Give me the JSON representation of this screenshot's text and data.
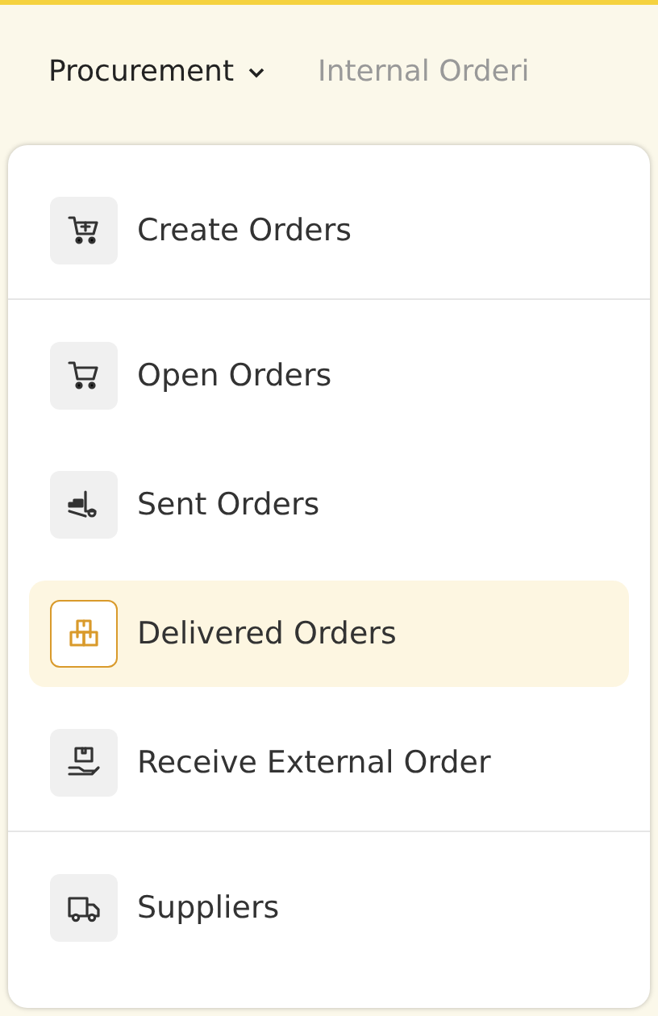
{
  "nav": [
    {
      "label": "Procurement",
      "selected": true,
      "dropdown": true
    },
    {
      "label": "Internal Orderi",
      "selected": false,
      "dropdown": false
    }
  ],
  "menu": {
    "groups": [
      {
        "items": [
          {
            "label": "Create Orders",
            "kind": "cart-plus",
            "selected": false
          }
        ]
      },
      {
        "items": [
          {
            "label": "Open Orders",
            "kind": "cart",
            "selected": false
          },
          {
            "label": "Sent Orders",
            "kind": "forklift",
            "selected": false
          },
          {
            "label": "Delivered Orders",
            "kind": "boxes",
            "selected": true
          },
          {
            "label": "Receive External Order",
            "kind": "hand-package",
            "selected": false
          }
        ]
      },
      {
        "items": [
          {
            "label": "Suppliers",
            "kind": "truck",
            "selected": false
          }
        ]
      }
    ]
  }
}
